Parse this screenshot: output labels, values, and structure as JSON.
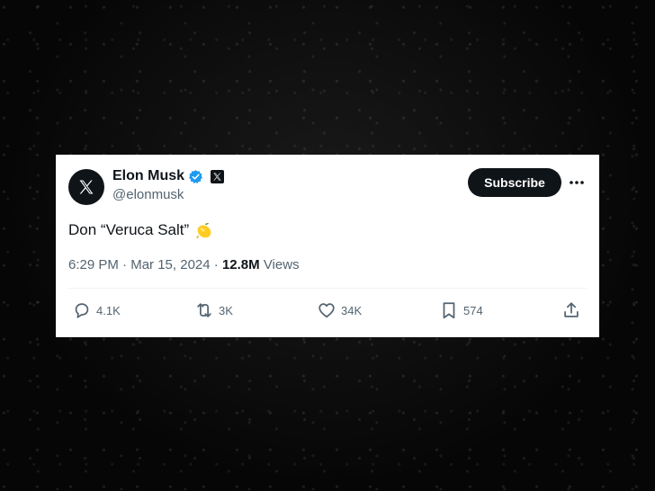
{
  "tweet": {
    "author": {
      "display_name": "Elon Musk",
      "handle": "@elonmusk",
      "avatar_icon": "x-logo-icon",
      "verified_icon": "verified-badge-icon",
      "verified_color": "#1d9bf0",
      "affiliation_icon": "x-affiliate-icon"
    },
    "subscribe_label": "Subscribe",
    "more_icon": "more-dots-icon",
    "text": "Don “Veruca Salt”",
    "emoji_icon": "lemon-icon",
    "meta": {
      "time": "6:29 PM",
      "separator": "·",
      "date": "Mar 15, 2024",
      "views_count": "12.8M",
      "views_label": "Views"
    },
    "actions": {
      "replies": "4.1K",
      "reposts": "3K",
      "likes": "34K",
      "bookmarks": "574"
    }
  },
  "colors": {
    "text_primary": "#0f1419",
    "text_secondary": "#536471",
    "background": "#050505",
    "card": "#ffffff"
  }
}
